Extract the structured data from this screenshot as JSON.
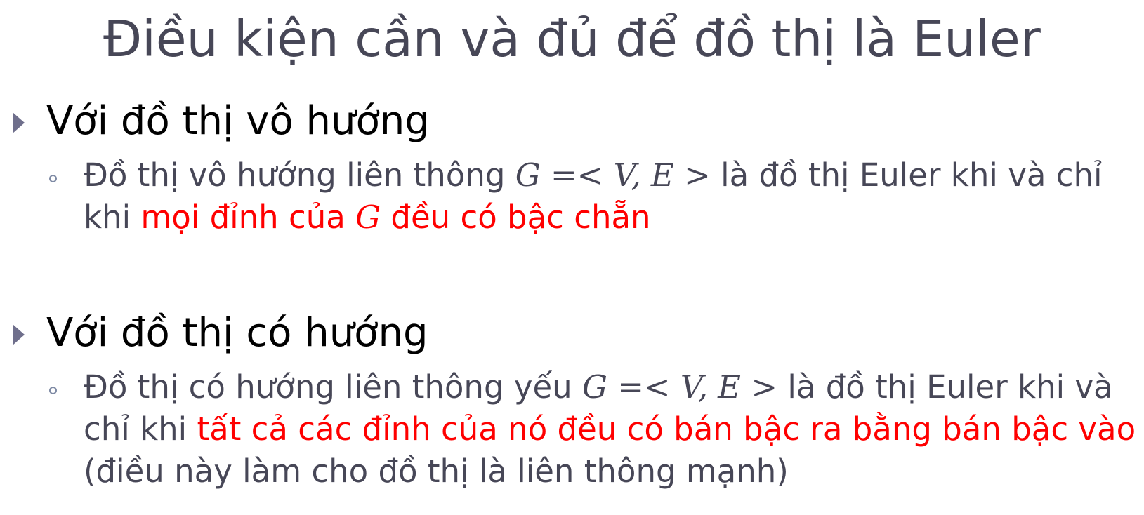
{
  "slide": {
    "title": "Điều kiện cần và đủ để đồ thị là Euler"
  },
  "sections": [
    {
      "heading": "Với đồ thị vô hướng",
      "item": {
        "text_before": "Đồ thị vô hướng liên thông ",
        "math": "G =< V, E >",
        "text_mid": " là đồ thị Euler khi và chỉ khi ",
        "highlight_1": "mọi đỉnh của ",
        "highlight_math": "G",
        "highlight_2": " đều có bậc chẵn"
      }
    },
    {
      "heading": "Với đồ thị có hướng",
      "item": {
        "text_before": "Đồ thị có hướng liên thông yếu ",
        "math": "G =< V, E >",
        "text_mid": " là đồ thị Euler khi và chỉ khi ",
        "highlight": "tất cả các đỉnh của nó đều có bán bậc ra bằng bán bậc vào",
        "text_after": " (điều này làm cho đồ thị là liên thông mạnh)"
      }
    }
  ],
  "colors": {
    "title": "#474757",
    "heading": "#000000",
    "body": "#474757",
    "highlight": "#ff0000",
    "bullet_marker": "#6f6f8c"
  }
}
